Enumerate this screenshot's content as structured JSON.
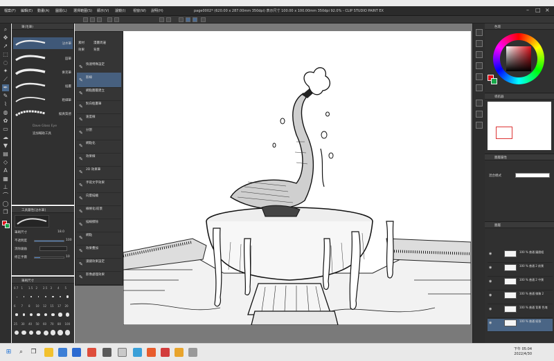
{
  "window": {
    "title": "page0002* (620.00 x 287.00mm 350dpi) 表示尺寸 100.00 x 100.00mm 350dpi 92.0% - CLIP STUDIO PAINT EX",
    "menus": [
      "檔案(F)",
      "編輯(E)",
      "動畫(A)",
      "圖層(L)",
      "選擇範圍(S)",
      "顯示(V)",
      "濾鏡(I)",
      "視窗(W)",
      "說明(H)"
    ]
  },
  "subtool_panel": {
    "title": "筆(毛筆)",
    "strokes": [
      {
        "label": "沾水筆"
      },
      {
        "label": "圓筆"
      },
      {
        "label": "麥克筆"
      },
      {
        "label": "插畫"
      },
      {
        "label": "粗細筆"
      },
      {
        "label": "擬真質感"
      }
    ],
    "footer": "Dave Glass Eye",
    "add_label": "追加輔助工具"
  },
  "tool_property": {
    "title": "工具屬性[沾水筆]",
    "brush_size_label": "筆刷尺寸",
    "brush_size_value": "18.0",
    "opacity_label": "不透明度",
    "opacity_value": "100",
    "antialias_label": "消除鋸齒",
    "stabilize_label": "修正手震",
    "stabilize_value": "10"
  },
  "brush_size": {
    "title": "筆刷尺寸",
    "sizes": [
      "0.7",
      "1",
      "1.5",
      "2",
      "2.5",
      "3",
      "4",
      "5",
      "6",
      "7",
      "8",
      "10",
      "12",
      "15",
      "17",
      "20",
      "25",
      "30",
      "40",
      "50",
      "60",
      "70",
      "80",
      "100"
    ]
  },
  "material_panel": {
    "tabs": [
      "素材",
      "漫畫周邊",
      "效果",
      "背景"
    ],
    "items": [
      {
        "label": "快速特殊設定",
        "icon": "settings-icon"
      },
      {
        "label": "影線",
        "icon": "hatch-icon"
      },
      {
        "label": "網點圖層建立",
        "icon": "layer-icon"
      },
      {
        "label": "對白框畫筆",
        "icon": "bubble-icon"
      },
      {
        "label": "速度線",
        "icon": "line-icon"
      },
      {
        "label": "分割",
        "icon": "split-icon"
      },
      {
        "label": "網點化",
        "icon": "tone-icon"
      },
      {
        "label": "效果線",
        "icon": "effect-icon"
      },
      {
        "label": "2D 效果筆",
        "icon": "pen-icon"
      },
      {
        "label": "手寫文字效果",
        "icon": "text-icon"
      },
      {
        "label": "向量描繪",
        "icon": "vector-icon"
      },
      {
        "label": "線條化/前景",
        "icon": "lineart-icon"
      },
      {
        "label": "描線擦除",
        "icon": "erase-icon"
      },
      {
        "label": "網點",
        "icon": "dot-icon"
      },
      {
        "label": "效果疊加",
        "icon": "overlay-icon"
      },
      {
        "label": "濾鏡效果設定",
        "icon": "filter-icon"
      },
      {
        "label": "影像處理效果",
        "icon": "image-icon"
      }
    ]
  },
  "color_panel": {
    "title": "色環",
    "main_color": "#e0101a",
    "sub_color": "#18a84a"
  },
  "navigator": {
    "title": "導航器"
  },
  "layer_property": {
    "title": "圖層屬性",
    "blend_label": "混合模式"
  },
  "layers": {
    "title": "圖層",
    "items": [
      {
        "name": "100 % 普通 圖層組"
      },
      {
        "name": "100 % 普通 2 前景"
      },
      {
        "name": "100 % 普通 2 中景"
      },
      {
        "name": "100 % 普通 線稿 2"
      },
      {
        "name": "100 % 普通 背景 色塊"
      },
      {
        "name": "100 % 普通 紙張"
      }
    ]
  },
  "taskbar": {
    "time": "下午 05:04",
    "date": "2022/4/30"
  }
}
